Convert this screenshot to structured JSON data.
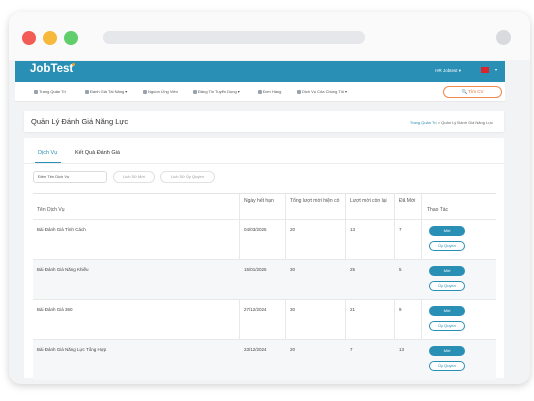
{
  "app": {
    "logo": "JobTest",
    "user_menu": "HR Jobtest ▾",
    "language_caret": "▾"
  },
  "menu": {
    "items": [
      {
        "label": "Trang Quản Trị",
        "icon": "home-icon"
      },
      {
        "label": "Đánh Giá Tài Năng ▾",
        "icon": "chart-icon"
      },
      {
        "label": "Nguồn Ứng Viên",
        "icon": "user-icon"
      },
      {
        "label": "Đăng Tin Tuyển Dụng ▾",
        "icon": "post-icon"
      },
      {
        "label": "Đơn Hàng",
        "icon": "cart-icon"
      },
      {
        "label": "Dịch Vụ Của Chúng Tôi ▾",
        "icon": "services-icon"
      }
    ],
    "find_cv": "🔍 Tìm CV"
  },
  "page": {
    "title": "Quản Lý Đánh Giá Năng Lực",
    "breadcrumb": {
      "home": "Trang Quản Trị",
      "sep": ">",
      "current": "Quản Lý Đánh Giá Năng Lực"
    }
  },
  "tabs": [
    {
      "label": "Dịch Vụ",
      "active": true
    },
    {
      "label": "Kết Quả Đánh Giá",
      "active": false
    }
  ],
  "filters": {
    "search_value": "Điền Tên Dịch Vụ",
    "history_invite": "Lịch Sử Mời",
    "history_delegate": "Lịch Sử Ủy Quyền"
  },
  "table": {
    "headers": {
      "service_name": "Tên Dịch Vụ",
      "expiry": "Ngày hết hạn",
      "total_invites": "Tổng lượt mời hiện có",
      "remaining": "Lượt mời còn lại",
      "invited": "Đã Mời",
      "actions": "Thao Tác"
    },
    "rows": [
      {
        "name": "Bài Đánh Giá Tính Cách",
        "expiry": "04/03/2025",
        "total": "20",
        "remaining": "13",
        "invited": "7"
      },
      {
        "name": "Bài Đánh Giá Năng Khiếu",
        "expiry": "15/01/2025",
        "total": "30",
        "remaining": "25",
        "invited": "5"
      },
      {
        "name": "Bài Đánh Giá 360",
        "expiry": "27/12/2024",
        "total": "30",
        "remaining": "21",
        "invited": "9"
      },
      {
        "name": "Bài Đánh Giá Năng Lực Tổng Hợp",
        "expiry": "23/12/2024",
        "total": "20",
        "remaining": "7",
        "invited": "13"
      }
    ],
    "action_invite": "Mời",
    "action_delegate": "Ủy Quyền"
  },
  "colors": {
    "brand": "#2a8fb4",
    "accent_orange": "#e9702e",
    "flag_red": "#d8262b"
  }
}
